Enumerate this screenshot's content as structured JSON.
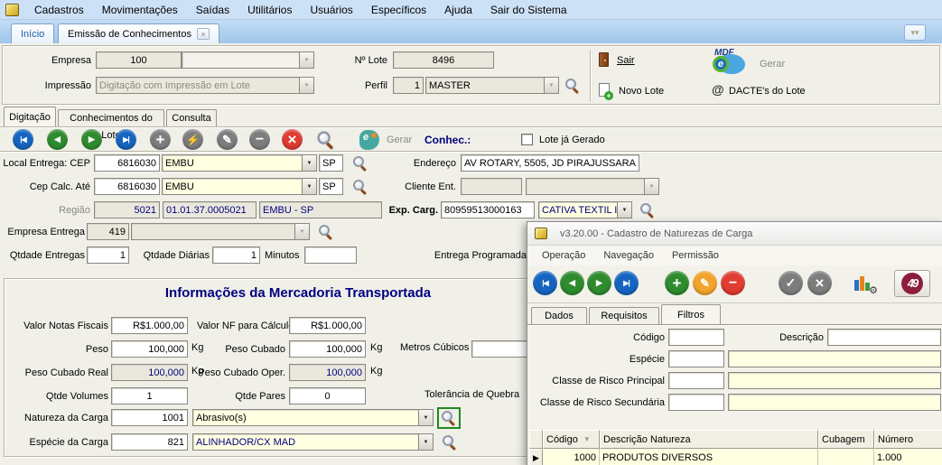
{
  "menubar": {
    "items": [
      "Cadastros",
      "Movimentações",
      "Saídas",
      "Utilitários",
      "Usuários",
      "Específicos",
      "Ajuda",
      "Sair do Sistema"
    ]
  },
  "main_tabs": {
    "inicio": "Início",
    "emissao": "Emissão de Conhecimentos"
  },
  "header": {
    "empresa_label": "Empresa",
    "empresa_code": "100",
    "num_lote_label": "Nº Lote",
    "num_lote_value": "8496",
    "impressao_label": "Impressão",
    "impressao_value": "Digitação com Impressão em Lote",
    "perfil_label": "Perfil",
    "perfil_code": "1",
    "perfil_value": "MASTER",
    "sair_label": "Sair",
    "gerar_label": "Gerar",
    "novo_lote_label": "Novo Lote",
    "dacte_label": "DACTE's do Lote",
    "mdfe_word": "MDF",
    "mdfe_e": "e"
  },
  "sub_tabs": {
    "digitacao": "Digitação",
    "conhecimentos": "Conhecimentos do Lote",
    "consulta": "Consulta"
  },
  "toolbar": {
    "gerar_label": "Gerar",
    "conhec_label": "Conhec.:",
    "lote_gerado_label": "Lote já Gerado"
  },
  "entrega": {
    "local_label": "Local Entrega: CEP",
    "local_cep": "6816030",
    "local_cidade": "EMBU",
    "local_uf": "SP",
    "endereco_label": "Endereço",
    "endereco_value": "AV ROTARY, 5505, JD PIRAJUSSARA",
    "cep_calc_label": "Cep Calc. Até",
    "cep_calc_cep": "6816030",
    "cep_calc_cidade": "EMBU",
    "cep_calc_uf": "SP",
    "cliente_ent_label": "Cliente Ent.",
    "regiao_label": "Região",
    "regiao_code": "5021",
    "regiao_ref": "01.01.37.0005021",
    "regiao_desc": "EMBU - SP",
    "exp_carg_label": "Exp. Carg.",
    "exp_carg_cnpj": "80959513000163",
    "exp_carg_nome": "CATIVA TEXTIL IN",
    "empresa_entrega_label": "Empresa Entrega",
    "empresa_entrega_code": "419",
    "qtd_entregas_label": "Qtdade Entregas",
    "qtd_entregas_value": "1",
    "qtd_diarias_label": "Qtdade Diárias",
    "qtd_diarias_value": "1",
    "minutos_label": "Minutos",
    "entrega_programada_label": "Entrega Programada"
  },
  "mercadoria": {
    "title": "Informações da Mercadoria Transportada",
    "valor_nf_label": "Valor Notas Fiscais",
    "valor_nf_value": "R$1.000,00",
    "valor_calc_label": "Valor NF para Cálculo",
    "valor_calc_value": "R$1.000,00",
    "peso_label": "Peso",
    "peso_value": "100,000",
    "kg": "Kg",
    "peso_cubado_label": "Peso Cubado",
    "peso_cubado_value": "100,000",
    "metros_cubicos_label": "Metros Cúbicos",
    "pcr_label": "Peso Cubado Real",
    "pcr_value": "100,000",
    "pco_label": "Peso Cubado Oper.",
    "pco_value": "100,000",
    "qtde_volumes_label": "Qtde Volumes",
    "qtde_volumes_value": "1",
    "qtde_pares_label": "Qtde Pares",
    "qtde_pares_value": "0",
    "tolerancia_label": "Tolerância de Quebra",
    "natureza_label": "Natureza da Carga",
    "natureza_code": "1001",
    "natureza_value": "Abrasivo(s)",
    "especie_label": "Espécie da Carga",
    "especie_code": "821",
    "especie_value": "ALINHADOR/CX MAD"
  },
  "popup": {
    "title": "v3.20.00 - Cadastro de Naturezas de Carga",
    "menu": [
      "Operação",
      "Navegação",
      "Permissão"
    ],
    "tabs": [
      "Dados",
      "Requisitos",
      "Filtros"
    ],
    "badge": "49",
    "fields": {
      "codigo_label": "Código",
      "descricao_label": "Descrição",
      "especie_label": "Espécie",
      "classe_principal_label": "Classe de Risco Principal",
      "classe_secundaria_label": "Classe de Risco Secundária"
    },
    "grid": {
      "columns": [
        "Código",
        "Descrição Natureza",
        "Cubagem",
        "Número"
      ],
      "rows": [
        {
          "codigo": "1000",
          "descricao": "PRODUTOS DIVERSOS",
          "cubagem": "",
          "numero": "1.000"
        }
      ]
    }
  },
  "colors": {
    "accent_navy": "#000080",
    "field_yellow": "#ffffe1",
    "highlight_green": "#1e8a1e"
  }
}
